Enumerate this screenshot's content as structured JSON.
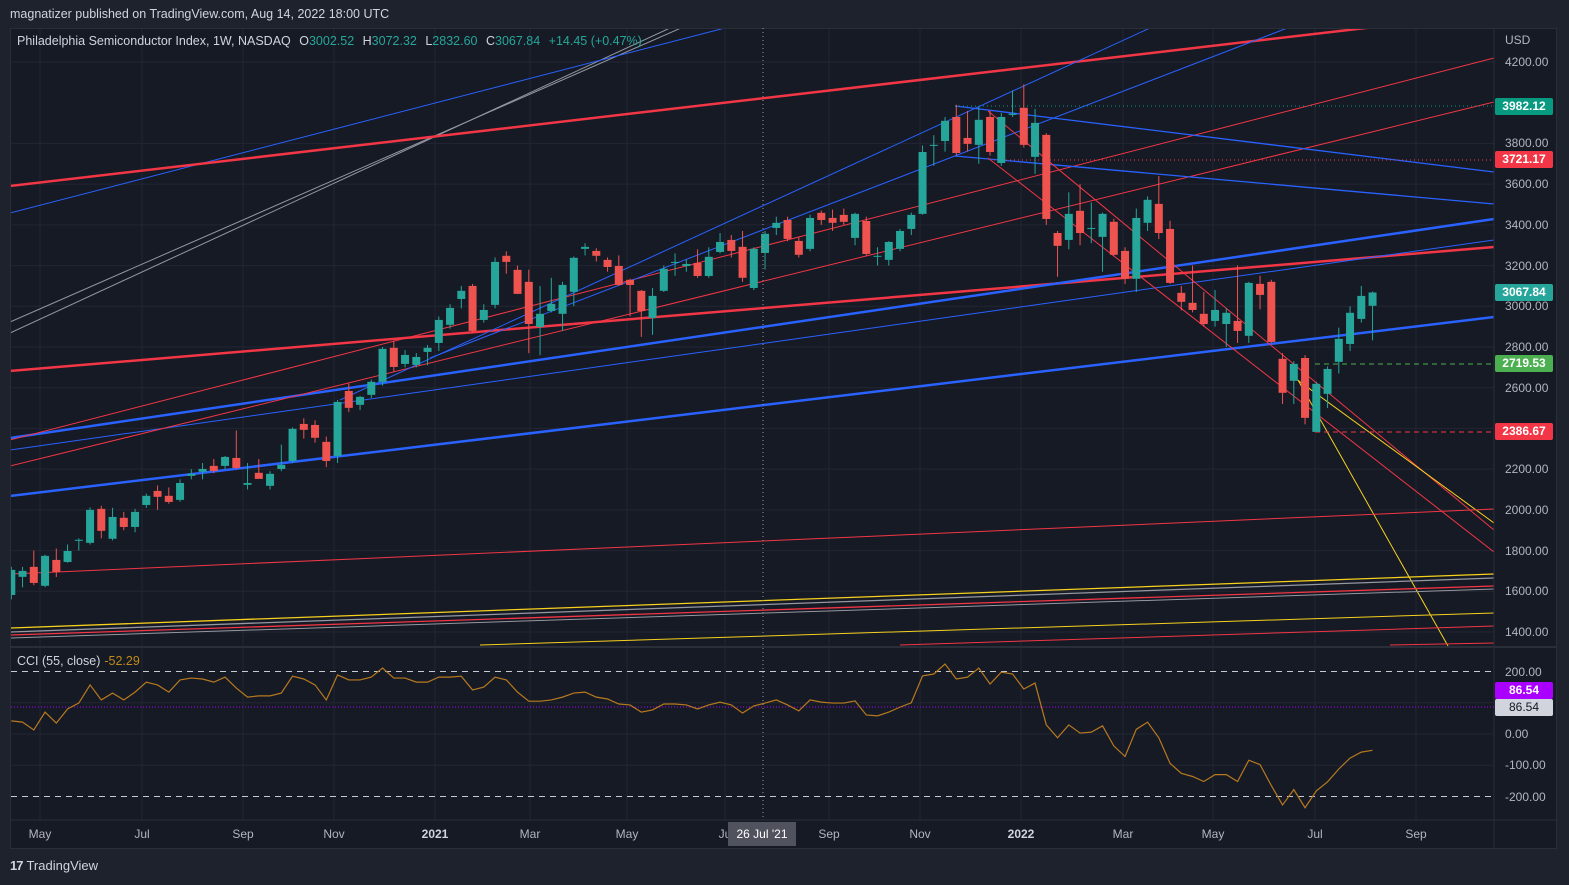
{
  "publisher": "magnatizer published on TradingView.com, Aug 14, 2022 18:00 UTC",
  "legend": {
    "symbol": "Philadelphia Semiconductor Index, 1W, NASDAQ",
    "o_label": "O",
    "o": "3002.52",
    "h_label": "H",
    "h": "3072.32",
    "l_label": "L",
    "l": "2832.60",
    "c_label": "C",
    "c": "3067.84",
    "change": "+14.45 (+0.47%)"
  },
  "cci_legend": {
    "name": "CCI (55, close)",
    "value": "-52.29"
  },
  "currency": "USD",
  "crosshair_label": "26 Jul '21",
  "footer": {
    "logo_mark": "17",
    "logo_text": "TradingView"
  },
  "colors": {
    "up": "#26a69a",
    "down": "#ef5350",
    "cci": "#b7791f",
    "cci_level": "#aa00ff",
    "background": "#161a25"
  },
  "chart_data": [
    {
      "type": "candlestick",
      "title": "Philadelphia Semiconductor Index, 1W, NASDAQ",
      "interval": "1W",
      "ylim": [
        1400,
        4300
      ],
      "y_ticks": [
        "4200.00",
        "3800.00",
        "3600.00",
        "3400.00",
        "3200.00",
        "3000.00",
        "2800.00",
        "2600.00",
        "2400.00",
        "2200.00",
        "2000.00",
        "1800.00",
        "1600.00",
        "1400.00"
      ],
      "x_ticks": [
        "May",
        "Jul",
        "Sep",
        "Nov",
        "2021",
        "Mar",
        "May",
        "Ju",
        "Sep",
        "Nov",
        "2022",
        "Mar",
        "May",
        "Jul",
        "Sep"
      ],
      "price_badges": [
        {
          "value": "3982.12",
          "color": "#089981"
        },
        {
          "value": "3721.17",
          "color": "#f23645"
        },
        {
          "value": "3067.84",
          "color": "#26a69a"
        },
        {
          "value": "2719.53",
          "color": "#4caf50"
        },
        {
          "value": "2386.67",
          "color": "#f23645"
        }
      ],
      "ohlc": [
        [
          1582,
          1720,
          1560,
          1705
        ],
        [
          1671,
          1720,
          1620,
          1700
        ],
        [
          1720,
          1800,
          1630,
          1641
        ],
        [
          1627,
          1780,
          1620,
          1774
        ],
        [
          1754,
          1810,
          1670,
          1695
        ],
        [
          1744,
          1830,
          1740,
          1798
        ],
        [
          1848,
          1860,
          1800,
          1853
        ],
        [
          1838,
          2012,
          1830,
          2000
        ],
        [
          2005,
          2020,
          1860,
          1897
        ],
        [
          1858,
          2010,
          1850,
          1965
        ],
        [
          1961,
          1990,
          1900,
          1916
        ],
        [
          1916,
          2005,
          1890,
          1990
        ],
        [
          2024,
          2080,
          2010,
          2069
        ],
        [
          2093,
          2120,
          2000,
          2064
        ],
        [
          2069,
          2110,
          2030,
          2039
        ],
        [
          2049,
          2150,
          2040,
          2132
        ],
        [
          2167,
          2200,
          2150,
          2177
        ],
        [
          2187,
          2230,
          2150,
          2201
        ],
        [
          2216,
          2250,
          2180,
          2191
        ],
        [
          2216,
          2265,
          2200,
          2260
        ],
        [
          2255,
          2390,
          2200,
          2206
        ],
        [
          2123,
          2230,
          2100,
          2132
        ],
        [
          2182,
          2250,
          2160,
          2152
        ],
        [
          2118,
          2190,
          2100,
          2177
        ],
        [
          2201,
          2320,
          2190,
          2221
        ],
        [
          2240,
          2405,
          2230,
          2398
        ],
        [
          2422,
          2450,
          2350,
          2393
        ],
        [
          2417,
          2440,
          2330,
          2354
        ],
        [
          2334,
          2360,
          2210,
          2240
        ],
        [
          2265,
          2540,
          2230,
          2530
        ],
        [
          2584,
          2620,
          2480,
          2501
        ],
        [
          2516,
          2560,
          2490,
          2555
        ],
        [
          2565,
          2640,
          2550,
          2629
        ],
        [
          2629,
          2800,
          2610,
          2791
        ],
        [
          2796,
          2830,
          2680,
          2702
        ],
        [
          2717,
          2785,
          2700,
          2761
        ],
        [
          2712,
          2770,
          2700,
          2751
        ],
        [
          2776,
          2810,
          2710,
          2796
        ],
        [
          2820,
          2950,
          2780,
          2933
        ],
        [
          2909,
          3010,
          2890,
          2992
        ],
        [
          3036,
          3100,
          2990,
          3076
        ],
        [
          3100,
          3110,
          2870,
          2879
        ],
        [
          2933,
          3010,
          2920,
          2982
        ],
        [
          3007,
          3240,
          2990,
          3218
        ],
        [
          3248,
          3270,
          3160,
          3218
        ],
        [
          3179,
          3200,
          3060,
          3061
        ],
        [
          3120,
          3180,
          2770,
          2913
        ],
        [
          2899,
          3100,
          2760,
          2963
        ],
        [
          2977,
          3140,
          2970,
          3012
        ],
        [
          2963,
          3120,
          2880,
          3105
        ],
        [
          3071,
          3245,
          3000,
          3238
        ],
        [
          3282,
          3310,
          3250,
          3292
        ],
        [
          3272,
          3285,
          3220,
          3248
        ],
        [
          3228,
          3240,
          3170,
          3193
        ],
        [
          3198,
          3250,
          3100,
          3105
        ],
        [
          3130,
          3135,
          2950,
          3105
        ],
        [
          3076,
          3080,
          2850,
          2977
        ],
        [
          2943,
          3090,
          2860,
          3051
        ],
        [
          3076,
          3200,
          3070,
          3184
        ],
        [
          3213,
          3260,
          3150,
          3218
        ],
        [
          3198,
          3230,
          3170,
          3208
        ],
        [
          3213,
          3280,
          3140,
          3149
        ],
        [
          3149,
          3290,
          3140,
          3243
        ],
        [
          3267,
          3360,
          3260,
          3316
        ],
        [
          3326,
          3350,
          3240,
          3272
        ],
        [
          3292,
          3370,
          3120,
          3140
        ],
        [
          3090,
          3290,
          3080,
          3282
        ],
        [
          3262,
          3370,
          3180,
          3356
        ],
        [
          3385,
          3440,
          3350,
          3410
        ],
        [
          3424,
          3440,
          3320,
          3331
        ],
        [
          3321,
          3340,
          3240,
          3253
        ],
        [
          3282,
          3450,
          3270,
          3434
        ],
        [
          3459,
          3470,
          3400,
          3424
        ],
        [
          3434,
          3475,
          3370,
          3410
        ],
        [
          3449,
          3480,
          3400,
          3415
        ],
        [
          3336,
          3460,
          3300,
          3454
        ],
        [
          3419,
          3440,
          3250,
          3257
        ],
        [
          3243,
          3290,
          3200,
          3248
        ],
        [
          3228,
          3320,
          3200,
          3316
        ],
        [
          3282,
          3380,
          3270,
          3370
        ],
        [
          3380,
          3460,
          3350,
          3449
        ],
        [
          3454,
          3790,
          3450,
          3758
        ],
        [
          3788,
          3840,
          3690,
          3793
        ],
        [
          3812,
          3930,
          3760,
          3911
        ],
        [
          3930,
          3990,
          3740,
          3753
        ],
        [
          3827,
          3960,
          3760,
          3798
        ],
        [
          3793,
          3980,
          3700,
          3916
        ],
        [
          3930,
          3960,
          3740,
          3758
        ],
        [
          3704,
          3950,
          3690,
          3930
        ],
        [
          3940,
          4060,
          3930,
          3946
        ],
        [
          3975,
          4090,
          3780,
          3793
        ],
        [
          3734,
          3970,
          3650,
          3901
        ],
        [
          3842,
          3850,
          3400,
          3429
        ],
        [
          3360,
          3370,
          3145,
          3297
        ],
        [
          3326,
          3560,
          3280,
          3454
        ],
        [
          3469,
          3600,
          3300,
          3360
        ],
        [
          3380,
          3510,
          3310,
          3385
        ],
        [
          3341,
          3460,
          3170,
          3454
        ],
        [
          3415,
          3430,
          3250,
          3253
        ],
        [
          3272,
          3290,
          3110,
          3135
        ],
        [
          3135,
          3480,
          3070,
          3434
        ],
        [
          3410,
          3540,
          3370,
          3523
        ],
        [
          3503,
          3640,
          3330,
          3360
        ],
        [
          3380,
          3420,
          3110,
          3115
        ],
        [
          3066,
          3100,
          2980,
          3022
        ],
        [
          3017,
          3200,
          2970,
          2982
        ],
        [
          2963,
          3070,
          2900,
          2913
        ],
        [
          2928,
          3080,
          2900,
          2982
        ],
        [
          2913,
          2990,
          2800,
          2968
        ],
        [
          2928,
          3200,
          2820,
          2879
        ],
        [
          2855,
          3120,
          2820,
          3115
        ],
        [
          3110,
          3150,
          2985,
          3056
        ],
        [
          3120,
          3130,
          2820,
          2825
        ],
        [
          2742,
          2770,
          2520,
          2575
        ],
        [
          2634,
          2730,
          2520,
          2717
        ],
        [
          2746,
          2760,
          2420,
          2452
        ],
        [
          2383,
          2630,
          2383,
          2619
        ],
        [
          2570,
          2705,
          2500,
          2692
        ],
        [
          2727,
          2895,
          2670,
          2840
        ],
        [
          2815,
          3000,
          2780,
          2968
        ],
        [
          2938,
          3100,
          2920,
          3051
        ],
        [
          3002.52,
          3072.32,
          2832.6,
          3067.84
        ]
      ]
    },
    {
      "type": "line",
      "title": "CCI (55, close)",
      "ylim": [
        -270,
        250
      ],
      "y_ticks": [
        "200.00",
        "0.00",
        "-100.00",
        "-200.00"
      ],
      "levels": [
        200,
        -200
      ],
      "signal_level": {
        "value": 86.54,
        "labels": [
          "86.54",
          "86.54"
        ]
      },
      "values": [
        42,
        38,
        13,
        70,
        35,
        80,
        99,
        157,
        109,
        131,
        109,
        134,
        166,
        157,
        134,
        173,
        179,
        176,
        166,
        182,
        147,
        118,
        122,
        122,
        131,
        185,
        176,
        157,
        109,
        189,
        173,
        173,
        182,
        211,
        179,
        179,
        166,
        166,
        182,
        182,
        185,
        141,
        150,
        182,
        173,
        134,
        105,
        105,
        109,
        118,
        131,
        134,
        118,
        112,
        96,
        93,
        70,
        77,
        96,
        96,
        93,
        80,
        93,
        102,
        93,
        67,
        90,
        99,
        109,
        93,
        74,
        109,
        102,
        99,
        99,
        106,
        61,
        58,
        70,
        86,
        100,
        186,
        192,
        224,
        176,
        182,
        211,
        160,
        198,
        192,
        144,
        163,
        29,
        -12,
        29,
        3,
        6,
        26,
        -38,
        -72,
        15,
        38,
        -12,
        -94,
        -126,
        -136,
        -152,
        -130,
        -130,
        -152,
        -84,
        -98,
        -165,
        -227,
        -178,
        -236,
        -182,
        -153,
        -112,
        -77,
        -58,
        -52.29
      ]
    }
  ]
}
